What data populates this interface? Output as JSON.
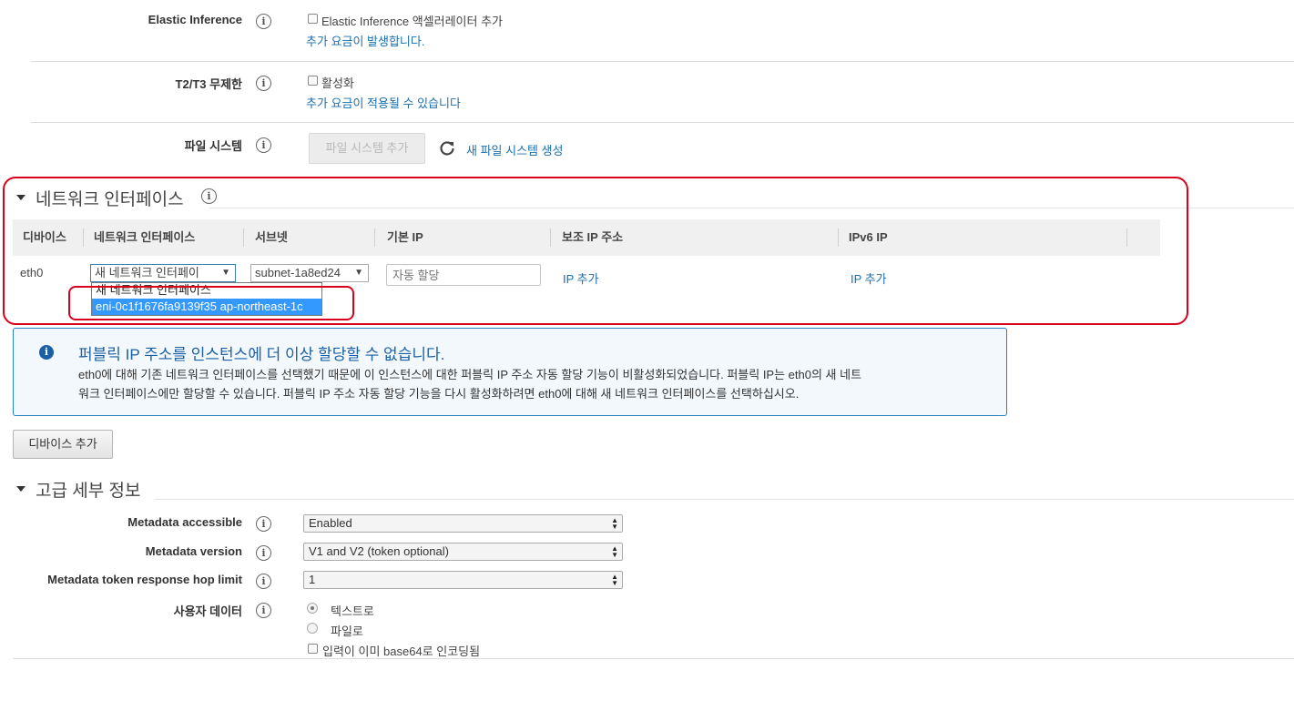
{
  "top_rows": {
    "elastic_inference": {
      "label": "Elastic Inference",
      "checkbox_label": "Elastic Inference 액셀러레이터 추가",
      "note": "추가 요금이 발생합니다."
    },
    "t2t3": {
      "label": "T2/T3 무제한",
      "checkbox_label": "활성화",
      "note": "추가 요금이 적용될 수 있습니다"
    },
    "file_system": {
      "label": "파일 시스템",
      "add_button": "파일 시스템 추가",
      "refresh_icon": "refresh-icon",
      "create_link": "새 파일 시스템 생성"
    }
  },
  "network": {
    "title": "네트워크 인터페이스",
    "columns": [
      "디바이스",
      "네트워크 인터페이스",
      "서브넷",
      "기본 IP",
      "보조 IP 주소",
      "IPv6 IP"
    ],
    "row": {
      "device": "eth0",
      "interface_select": "새 네트워크 인터페이",
      "subnet_select": "subnet-1a8ed24",
      "primary_ip_placeholder": "자동 할당",
      "secondary_ip_link": "IP 추가",
      "ipv6_link": "IP 추가"
    },
    "dropdown_options": [
      "새 네트워크 인터페이스",
      "eni-0c1f1676fa9139f35 ap-northeast-1c"
    ],
    "dropdown_selected_index": 1
  },
  "alert": {
    "icon": "info-icon",
    "title": "퍼블릭 IP 주소를 인스턴스에 더 이상 할당할 수 없습니다.",
    "line1": "eth0에 대해 기존 네트워크 인터페이스를 선택했기 때문에 이 인스턴스에 대한 퍼블릭 IP 주소 자동 할당 기능이 비활성화되었습니다. 퍼블릭 IP는 eth0의 새 네트",
    "line2": "워크 인터페이스에만 할당할 수 있습니다. 퍼블릭 IP 주소 자동 할당 기능을 다시 활성화하려면 eth0에 대해 새 네트워크 인터페이스를 선택하십시오."
  },
  "add_device_button": "디바이스 추가",
  "advanced": {
    "title": "고급 세부 정보",
    "metadata_accessible": {
      "label": "Metadata accessible",
      "value": "Enabled"
    },
    "metadata_version": {
      "label": "Metadata version",
      "value": "V1 and V2 (token optional)"
    },
    "hop_limit": {
      "label": "Metadata token response hop limit",
      "value": "1"
    },
    "user_data": {
      "label": "사용자 데이터",
      "radio_text": "텍스트로",
      "radio_file": "파일로",
      "checkbox_base64": "입력이 이미 base64로 인코딩됨"
    }
  },
  "colors": {
    "link": "#1b6fae",
    "alert_border": "#2c7fc0",
    "alert_bg": "#f3f8fd",
    "highlight_red": "#d9001b",
    "selected_option": "#3399ff"
  }
}
